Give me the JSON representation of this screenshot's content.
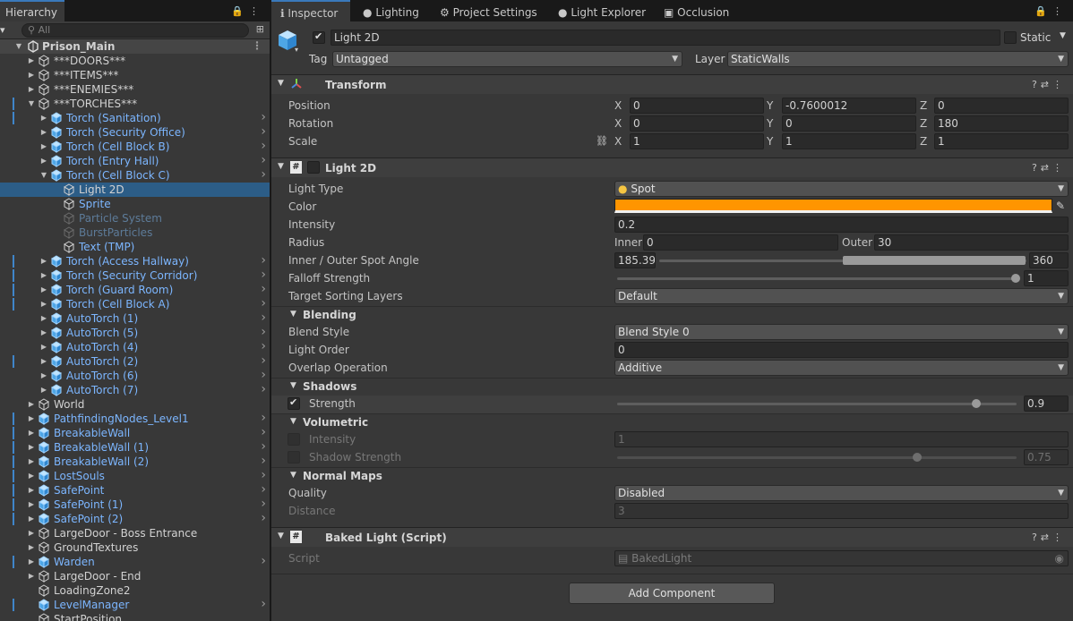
{
  "hierarchy": {
    "tab_label": "Hierarchy",
    "tab_icons": "🔒 ⋮",
    "search_placeholder": "All",
    "scene_name": "Prison_Main",
    "items": [
      {
        "label": "***DOORS***"
      },
      {
        "label": "***ITEMS***"
      },
      {
        "label": "***ENEMIES***"
      },
      {
        "label": "***TORCHES***"
      },
      {
        "label": "Torch (Sanitation)"
      },
      {
        "label": "Torch (Security Office)"
      },
      {
        "label": "Torch (Cell Block B)"
      },
      {
        "label": "Torch (Entry Hall)"
      },
      {
        "label": "Torch (Cell Block C)"
      },
      {
        "label": "Light 2D"
      },
      {
        "label": "Sprite"
      },
      {
        "label": "Particle System"
      },
      {
        "label": "BurstParticles"
      },
      {
        "label": "Text (TMP)"
      },
      {
        "label": "Torch (Access Hallway)"
      },
      {
        "label": "Torch (Security Corridor)"
      },
      {
        "label": "Torch (Guard Room)"
      },
      {
        "label": "Torch (Cell Block A)"
      },
      {
        "label": "AutoTorch (1)"
      },
      {
        "label": "AutoTorch (5)"
      },
      {
        "label": "AutoTorch (4)"
      },
      {
        "label": "AutoTorch (2)"
      },
      {
        "label": "AutoTorch (6)"
      },
      {
        "label": "AutoTorch (7)"
      },
      {
        "label": "World"
      },
      {
        "label": "PathfindingNodes_Level1"
      },
      {
        "label": "BreakableWall"
      },
      {
        "label": "BreakableWall (1)"
      },
      {
        "label": "BreakableWall (2)"
      },
      {
        "label": "LostSouls"
      },
      {
        "label": "SafePoint"
      },
      {
        "label": "SafePoint (1)"
      },
      {
        "label": "SafePoint (2)"
      },
      {
        "label": "LargeDoor - Boss Entrance"
      },
      {
        "label": "GroundTextures"
      },
      {
        "label": "Warden"
      },
      {
        "label": "LargeDoor - End"
      },
      {
        "label": "LoadingZone2"
      },
      {
        "label": "LevelManager"
      },
      {
        "label": "StartPosition"
      }
    ]
  },
  "inspector": {
    "tabs": [
      {
        "label": "Inspector",
        "icon": "info-icon"
      },
      {
        "label": "Lighting",
        "icon": "bulb-icon"
      },
      {
        "label": "Project Settings",
        "icon": "gear-icon"
      },
      {
        "label": "Light Explorer",
        "icon": "bulb-icon"
      },
      {
        "label": "Occlusion",
        "icon": "occlusion-icon"
      }
    ],
    "object_name": "Light 2D",
    "static_label": "Static",
    "tag_label": "Tag",
    "tag_value": "Untagged",
    "layer_label": "Layer",
    "layer_value": "StaticWalls",
    "transform": {
      "title": "Transform",
      "position_label": "Position",
      "rotation_label": "Rotation",
      "scale_label": "Scale",
      "x": "X",
      "y": "Y",
      "z": "Z",
      "position": [
        "0",
        "-0.7600012",
        "0"
      ],
      "rotation": [
        "0",
        "0",
        "180"
      ],
      "scale": [
        "1",
        "1",
        "1"
      ]
    },
    "light2d": {
      "title": "Light 2D",
      "light_type_label": "Light Type",
      "light_type_value": "Spot",
      "color_label": "Color",
      "color_value": "#ff9500",
      "intensity_label": "Intensity",
      "intensity_value": "0.2",
      "radius_label": "Radius",
      "inner_label": "Inner",
      "inner_value": "0",
      "outer_label": "Outer",
      "outer_value": "30",
      "spot_angle_label": "Inner / Outer Spot Angle",
      "spot_inner_value": "185.39",
      "spot_outer_value": "360",
      "falloff_label": "Falloff Strength",
      "falloff_value": "1",
      "sorting_label": "Target Sorting Layers",
      "sorting_value": "Default",
      "blending_title": "Blending",
      "blend_style_label": "Blend Style",
      "blend_style_value": "Blend Style 0",
      "light_order_label": "Light Order",
      "light_order_value": "0",
      "overlap_label": "Overlap Operation",
      "overlap_value": "Additive",
      "shadows_title": "Shadows",
      "shadow_strength_label": "Strength",
      "shadow_strength_value": "0.9",
      "volumetric_title": "Volumetric",
      "vol_intensity_label": "Intensity",
      "vol_intensity_value": "1",
      "vol_shadow_label": "Shadow Strength",
      "vol_shadow_value": "0.75",
      "normal_maps_title": "Normal Maps",
      "quality_label": "Quality",
      "quality_value": "Disabled",
      "distance_label": "Distance",
      "distance_value": "3"
    },
    "baked": {
      "title": "Baked Light (Script)",
      "script_label": "Script",
      "script_value": "BakedLight"
    },
    "add_component_label": "Add Component"
  }
}
